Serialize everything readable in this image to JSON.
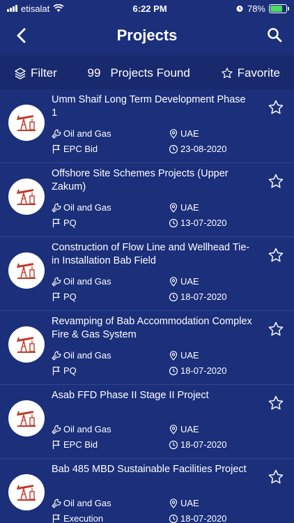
{
  "status_bar": {
    "carrier": "etisalat",
    "time": "6:22 PM",
    "battery": "78%",
    "battery_level": 0.78
  },
  "header": {
    "title": "Projects"
  },
  "toolbar": {
    "filter_label": "Filter",
    "count": "99",
    "found_label": "Projects Found",
    "favorite_label": "Favorite"
  },
  "projects": [
    {
      "title": "Umm Shaif Long Term Development Phase 1",
      "sector": "Oil and Gas",
      "country": "UAE",
      "stage": "EPC Bid",
      "date": "23-08-2020"
    },
    {
      "title": "Offshore Site Schemes Projects (Upper Zakum)",
      "sector": "Oil and Gas",
      "country": "UAE",
      "stage": "PQ",
      "date": "13-07-2020"
    },
    {
      "title": "Construction of Flow Line and Wellhead Tie-in Installation Bab Field",
      "sector": "Oil and Gas",
      "country": "UAE",
      "stage": "PQ",
      "date": "18-07-2020"
    },
    {
      "title": "Revamping of Bab Accommodation Complex Fire & Gas System",
      "sector": "Oil and Gas",
      "country": "UAE",
      "stage": "PQ",
      "date": "18-07-2020"
    },
    {
      "title": "Asab FFD Phase II Stage II Project",
      "sector": "Oil and Gas",
      "country": "UAE",
      "stage": "EPC Bid",
      "date": "18-07-2020"
    },
    {
      "title": "Bab 485 MBD Sustainable Facilities Project",
      "sector": "Oil and Gas",
      "country": "UAE",
      "stage": "Execution",
      "date": "18-07-2020"
    }
  ],
  "colors": {
    "background": "#1b2f7a",
    "toolbar": "#18296d",
    "divider": "#324690",
    "icon_accent": "#c0392b",
    "battery": "#4cd964"
  },
  "icons": {
    "project_avatar": "oil-pump-icon",
    "favorite": "star-outline-icon",
    "sector": "wrench-icon",
    "country": "location-pin-icon",
    "stage": "flag-icon",
    "date": "clock-icon"
  }
}
